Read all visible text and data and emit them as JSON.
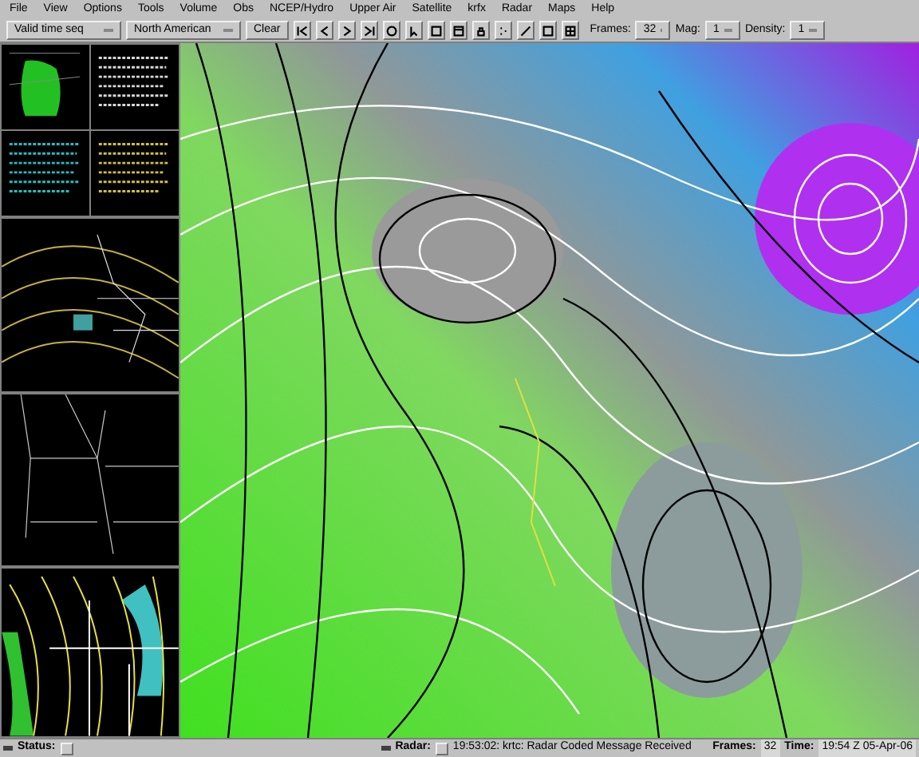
{
  "menu_bar": [
    "File",
    "View",
    "Options",
    "Tools",
    "Volume",
    "Obs",
    "NCEP/Hydro",
    "Upper Air",
    "Satellite",
    "krfx",
    "Radar",
    "Maps",
    "Help"
  ],
  "toolbar": {
    "sequence": "Valid time seq",
    "scale": "North American",
    "clear": "Clear",
    "frames_label": "Frames:",
    "frames": "32",
    "mag_label": "Mag:",
    "mag": "1",
    "density_label": "Density:",
    "density": "1"
  },
  "status_bar": {
    "status_label": "Status:",
    "radar_label": "Radar:",
    "message": "19:53:02: krtc: Radar Coded Message Received",
    "frames_label": "Frames:",
    "frames": "32",
    "time_label": "Time:",
    "time": "19:54 Z 05-Apr-06"
  }
}
